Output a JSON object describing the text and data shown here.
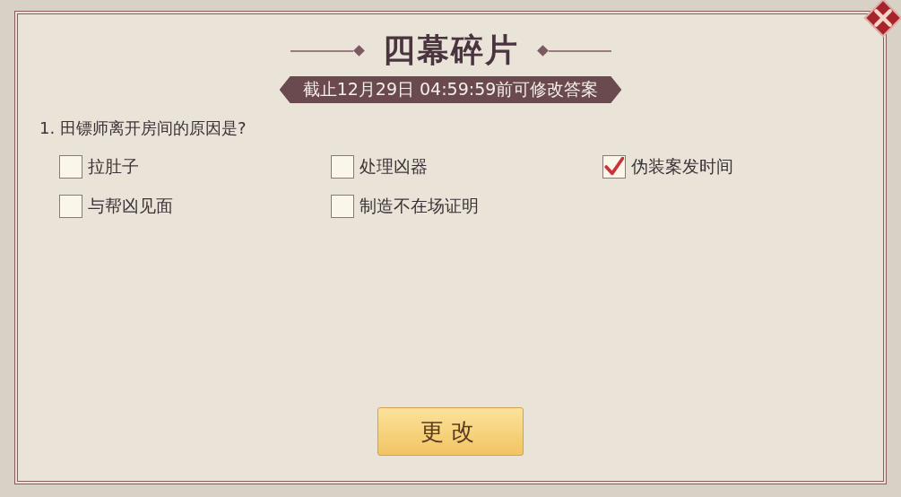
{
  "title": "四幕碎片",
  "deadline": "截止12月29日 04:59:59前可修改答案",
  "question": "1. 田镖师离开房间的原因是?",
  "options": [
    {
      "label": "拉肚子",
      "checked": false
    },
    {
      "label": "处理凶器",
      "checked": false
    },
    {
      "label": "伪装案发时间",
      "checked": true
    },
    {
      "label": "与帮凶见面",
      "checked": false
    },
    {
      "label": "制造不在场证明",
      "checked": false
    }
  ],
  "button": "更改"
}
